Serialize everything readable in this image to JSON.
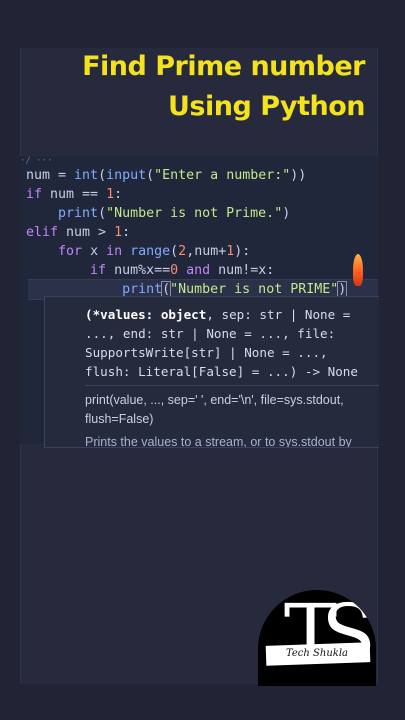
{
  "title": {
    "line1": "Find Prime number",
    "line2": "Using Python"
  },
  "editor": {
    "breadcrumb": "·/ ···",
    "code": {
      "l1_a": "num = ",
      "l1_b": "int",
      "l1_c": "(",
      "l1_d": "input",
      "l1_e": "(",
      "l1_f": "\"Enter a number:\"",
      "l1_g": "))",
      "l2_a": "if",
      "l2_b": " num == ",
      "l2_c": "1",
      "l2_d": ":",
      "l3_a": "    ",
      "l3_b": "print",
      "l3_c": "(",
      "l3_d": "\"Number is not Prime.\"",
      "l3_e": ")",
      "l4_a": "elif",
      "l4_b": " num > ",
      "l4_c": "1",
      "l4_d": ":",
      "l5_a": "    ",
      "l5_b": "for",
      "l5_c": " x ",
      "l5_d": "in",
      "l5_e": " ",
      "l5_f": "range",
      "l5_g": "(",
      "l5_h": "2",
      "l5_i": ",num+",
      "l5_j": "1",
      "l5_k": "):",
      "l6_a": "        ",
      "l6_b": "if",
      "l6_c": " num%x==",
      "l6_d": "0",
      "l6_e": " ",
      "l6_f": "and",
      "l6_g": " num!=x:",
      "l7_a": "            ",
      "l7_b": "print",
      "l7_c": "(",
      "l7_d": "\"Number is not PRIME\"",
      "l7_e": ")"
    }
  },
  "tooltip": {
    "sig1_a": "(*values: object",
    "sig1_b": ", sep: str | None =",
    "sig2": "..., end: str | None = ..., file:",
    "sig3": "SupportsWrite[str] | None = ...,",
    "sig4": "flush: Literal[False] = ...) -> None",
    "doc1": "print(value, ..., sep=' ', end='\\n', file=sys.stdout,",
    "doc2": "flush=False)",
    "doc_more": "Prints the values to a stream, or to sys.stdout by"
  },
  "logo": {
    "monogram": "TS",
    "name": "Tech Shukla"
  }
}
